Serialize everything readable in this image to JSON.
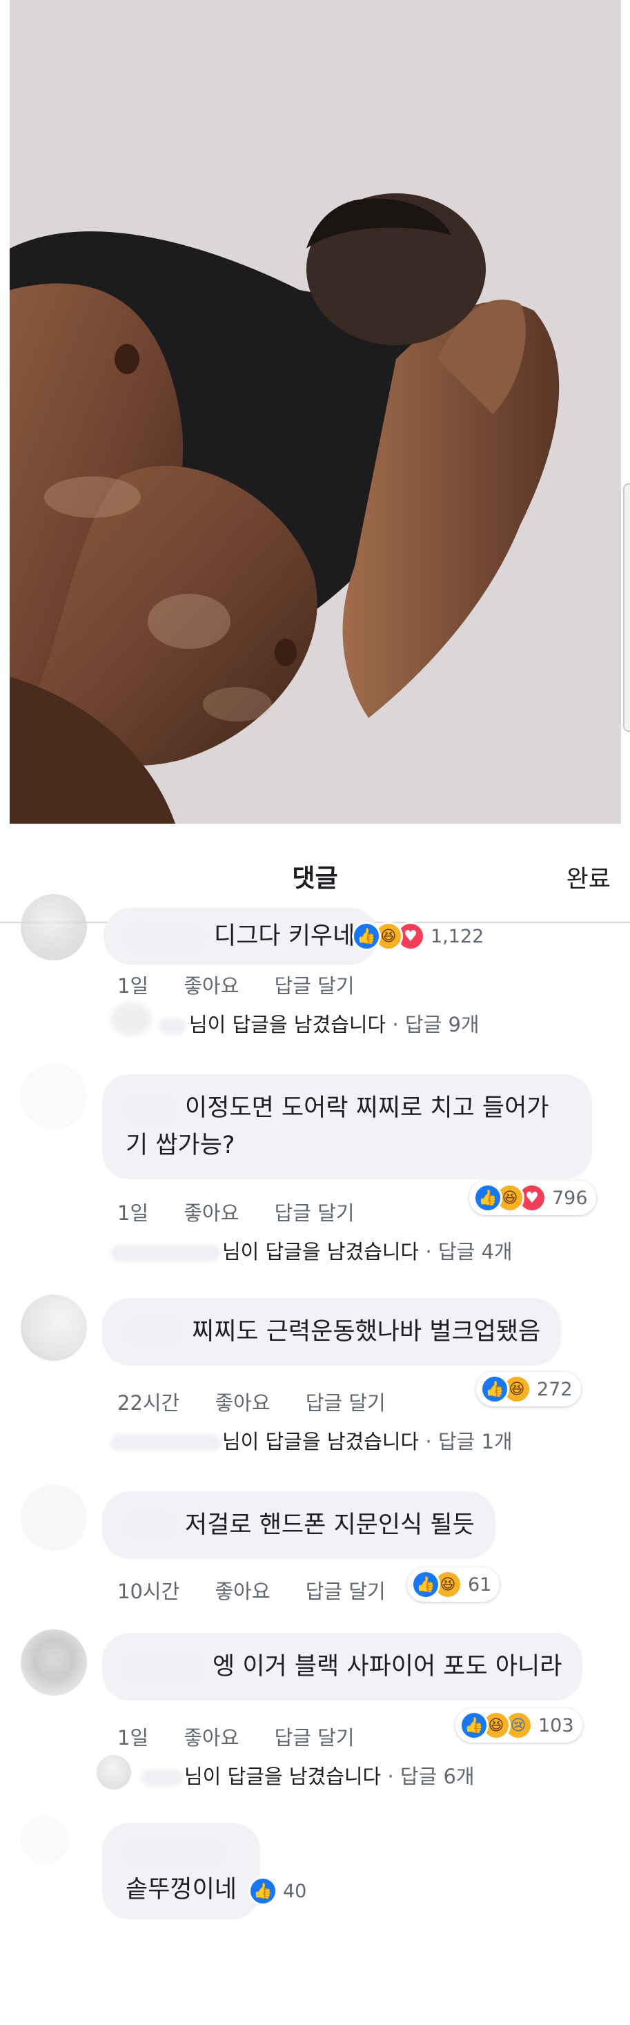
{
  "header": {
    "title": "댓글",
    "done_label": "완료"
  },
  "comments": [
    {
      "text": "디그다 키우네",
      "meta": {
        "time": "1일",
        "like": "좋아요",
        "reply": "답글 달기"
      },
      "reactions": {
        "icons": [
          "like",
          "haha",
          "love"
        ],
        "count": "1,122"
      },
      "replies": {
        "suffix": "님이 답글을 남겼습니다",
        "count_text": "· 답글 9개"
      }
    },
    {
      "text_line1": "이정도면 도어락 찌찌로 치고 들어가",
      "text_line2": "기 쌉가능?",
      "meta": {
        "time": "1일",
        "like": "좋아요",
        "reply": "답글 달기"
      },
      "reactions": {
        "icons": [
          "like",
          "haha",
          "love"
        ],
        "count": "796"
      },
      "replies": {
        "suffix": "님이 답글을 남겼습니다",
        "count_text": "· 답글 4개"
      }
    },
    {
      "text": "찌찌도 근력운동했나바 벌크업됐음",
      "meta": {
        "time": "22시간",
        "like": "좋아요",
        "reply": "답글 달기"
      },
      "reactions": {
        "icons": [
          "like",
          "haha"
        ],
        "count": "272"
      },
      "replies": {
        "suffix": "님이 답글을 남겼습니다",
        "count_text": "· 답글 1개"
      }
    },
    {
      "text": "저걸로 핸드폰 지문인식 될듯",
      "meta": {
        "time": "10시간",
        "like": "좋아요",
        "reply": "답글 달기"
      },
      "reactions": {
        "icons": [
          "like",
          "haha"
        ],
        "count": "61"
      }
    },
    {
      "text": "엥 이거 블랙 사파이어 포도 아니라",
      "meta": {
        "time": "1일",
        "like": "좋아요",
        "reply": "답글 달기"
      },
      "reactions": {
        "icons": [
          "like",
          "haha",
          "sad"
        ],
        "count": "103"
      },
      "replies": {
        "suffix": "님이 답글을 남겼습니다",
        "count_text": "· 답글 6개"
      }
    },
    {
      "text": "솥뚜껑이네",
      "reactions": {
        "icons": [
          "like"
        ],
        "count": "40"
      }
    }
  ],
  "colors": {
    "like": "#1877f2",
    "haha": "#f7b125",
    "love": "#f33e58",
    "bubble": "#f0f2f5",
    "muted": "#606770"
  }
}
